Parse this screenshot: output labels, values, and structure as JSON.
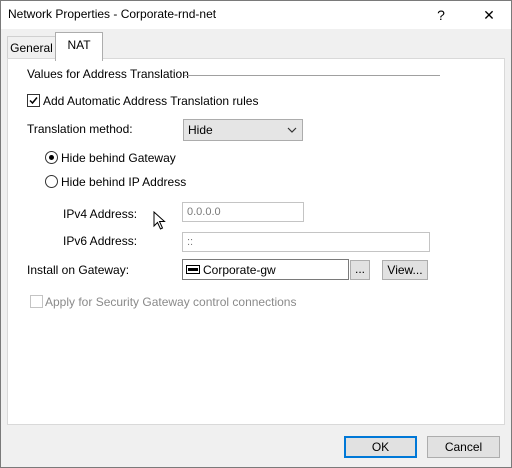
{
  "window": {
    "title": "Network Properties - Corporate-rnd-net",
    "help_label": "?",
    "close_label": "✕"
  },
  "tabs": [
    {
      "label": "General",
      "active": false
    },
    {
      "label": "NAT",
      "active": true
    }
  ],
  "nat": {
    "section_title": "Values for Address Translation",
    "auto_rules": {
      "label": "Add Automatic Address Translation rules",
      "checked": true
    },
    "method": {
      "label": "Translation method:",
      "value": "Hide"
    },
    "radios": [
      {
        "label": "Hide behind Gateway",
        "selected": true
      },
      {
        "label": "Hide behind IP Address",
        "selected": false
      }
    ],
    "ipv4": {
      "label": "IPv4 Address:",
      "value": "0.0.0.0"
    },
    "ipv6": {
      "label": "IPv6 Address:",
      "value": "::"
    },
    "install": {
      "label": "Install on Gateway:",
      "value": "Corporate-gw",
      "browse_label": "...",
      "view_label": "View..."
    },
    "apply_sg": {
      "label": "Apply for Security Gateway control connections",
      "checked": false,
      "enabled": false
    }
  },
  "buttons": {
    "ok": "OK",
    "cancel": "Cancel"
  },
  "icons": {
    "gateway": "gateway-icon",
    "cursor": "mouse-pointer-icon",
    "dropdown": "chevron-down-icon"
  }
}
